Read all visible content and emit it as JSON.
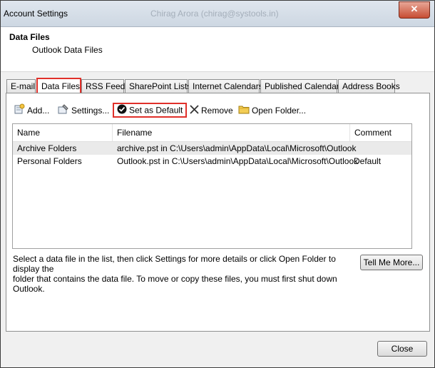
{
  "window": {
    "title": "Account Settings",
    "title_ghost": "Chirag Arora (chirag@systools.in)",
    "close_label": "✕"
  },
  "header": {
    "title": "Data Files",
    "subtitle": "Outlook Data Files"
  },
  "tabs": [
    {
      "label": "E-mail"
    },
    {
      "label": "Data Files"
    },
    {
      "label": "RSS Feeds"
    },
    {
      "label": "SharePoint Lists"
    },
    {
      "label": "Internet Calendars"
    },
    {
      "label": "Published Calendars"
    },
    {
      "label": "Address Books"
    }
  ],
  "toolbar": {
    "add": "Add...",
    "settings": "Settings...",
    "set_default": "Set as Default",
    "remove": "Remove",
    "open_folder": "Open Folder..."
  },
  "list": {
    "columns": [
      "Name",
      "Filename",
      "Comment"
    ],
    "rows": [
      {
        "name": "Archive Folders",
        "filename": "archive.pst in C:\\Users\\admin\\AppData\\Local\\Microsoft\\Outlook",
        "comment": ""
      },
      {
        "name": "Personal Folders",
        "filename": "Outlook.pst in C:\\Users\\admin\\AppData\\Local\\Microsoft\\Outlook",
        "comment": "Default"
      }
    ]
  },
  "info": {
    "line1": "Select a data file in the list, then click Settings for more details or click Open Folder to display the",
    "line2": "folder that contains the data file. To move or copy these files, you must first shut down Outlook."
  },
  "buttons": {
    "tell_me_more": "Tell Me More...",
    "close": "Close"
  },
  "colors": {
    "highlight": "#e0302a",
    "title_bar": "#cdd7e2"
  }
}
